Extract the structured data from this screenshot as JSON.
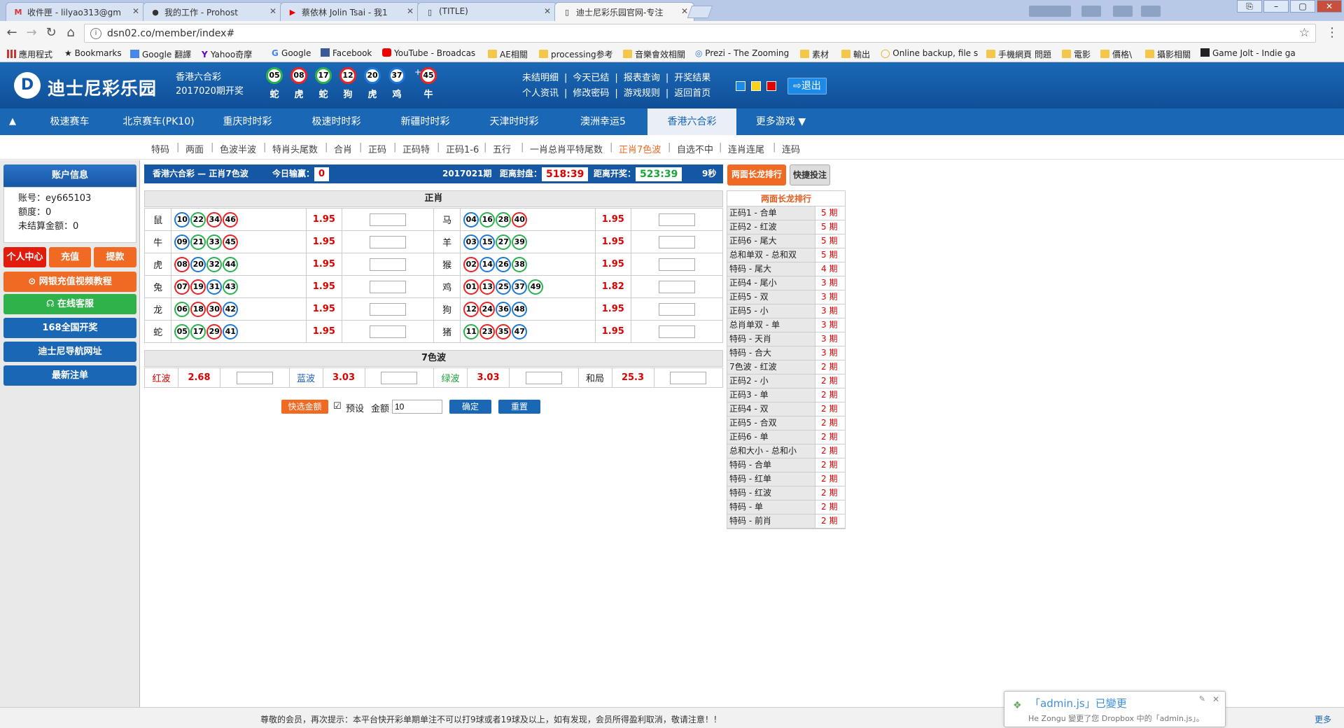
{
  "browser": {
    "tabs": [
      {
        "label": "收件匣 - lilyao313@gm",
        "icon": "gmail-icon"
      },
      {
        "label": "我的工作 - Prohost",
        "icon": "github-icon"
      },
      {
        "label": "蔡依林 Jolin Tsai - 我1",
        "icon": "youtube-icon"
      },
      {
        "label": "(TITLE)",
        "icon": "page-icon"
      },
      {
        "label": "迪士尼彩乐园官网-专注",
        "icon": "page-icon"
      }
    ],
    "url": "dsn02.co/member/index#",
    "bookmarks": [
      "應用程式",
      "Bookmarks",
      "Google 翻譯",
      "Yahoo奇摩",
      "Google",
      "Facebook",
      "YouTube - Broadcas",
      "AE相關",
      "processing参考",
      "音樂會效相關",
      "Prezi - The Zooming",
      "素材",
      "輸出",
      "Online backup, file s",
      "手機網頁 問題",
      "電影",
      "價格\\",
      "攝影相關",
      "Game Jolt - Indie ga"
    ]
  },
  "header": {
    "logo_mark": "D",
    "logo_name": "迪士尼彩乐园",
    "lottery_name": "香港六合彩",
    "period": "2017020期开奖",
    "draw": [
      {
        "num": "05",
        "zodiac": "蛇",
        "color": "green"
      },
      {
        "num": "08",
        "zodiac": "虎",
        "color": "red"
      },
      {
        "num": "17",
        "zodiac": "蛇",
        "color": "green"
      },
      {
        "num": "12",
        "zodiac": "狗",
        "color": "red"
      },
      {
        "num": "20",
        "zodiac": "虎",
        "color": "blue"
      },
      {
        "num": "37",
        "zodiac": "鸡",
        "color": "blue"
      },
      {
        "num": "45",
        "zodiac": "牛",
        "color": "red"
      }
    ],
    "plus": "+",
    "links_row1": [
      "未结明细",
      "今天已结",
      "报表查询",
      "开奖结果"
    ],
    "links_row2": [
      "个人资讯",
      "修改密码",
      "游戏规则",
      "返回首页"
    ],
    "logout": "退出",
    "theme_colors": [
      "#1e8ae8",
      "#f6d21b",
      "#e00000"
    ]
  },
  "nav": {
    "items": [
      "极速赛车",
      "北京赛车(PK10)",
      "重庆时时彩",
      "极速时时彩",
      "新疆时时彩",
      "天津时时彩",
      "澳洲幸运5",
      "香港六合彩",
      "更多游戏 ▼"
    ],
    "active_index": 7,
    "sub": [
      "特码",
      "两面",
      "色波半波",
      "特肖头尾数",
      "合肖",
      "正码",
      "正码特",
      "正码1-6",
      "五行",
      "一肖总肖平特尾数",
      "正肖7色波",
      "自选不中",
      "连肖连尾",
      "连码"
    ],
    "sub_active_index": 10
  },
  "sidebar": {
    "account_title": "账户信息",
    "account_no_label": "账号：ey665103",
    "credit_label": "额度：0",
    "unsettled_label": "未结算金额：0",
    "btn_center": "个人中心",
    "btn_deposit": "充值",
    "btn_withdraw": "提款",
    "btn_video": "网银充值视频教程",
    "btn_service": "在线客服",
    "btn_168": "168全国开奖",
    "btn_nav": "迪士尼导航网址",
    "btn_latest": "最新注单"
  },
  "betbar": {
    "title": "香港六合彩 — 正肖7色波",
    "today_label": "今日输赢：",
    "today_value": "0",
    "period": "2017021期",
    "close_label": "距离封盘：",
    "close_time": "518:39",
    "draw_label": "距离开奖：",
    "draw_time": "523:39",
    "refresh": "9秒"
  },
  "zhengxiao": {
    "title": "正肖",
    "rows": [
      [
        {
          "z": "鼠",
          "odds": "1.95",
          "balls": [
            [
              "10",
              "bl"
            ],
            [
              "22",
              "g"
            ],
            [
              "34",
              "r"
            ],
            [
              "46",
              "r"
            ]
          ]
        },
        {
          "z": "马",
          "odds": "1.95",
          "balls": [
            [
              "04",
              "bl"
            ],
            [
              "16",
              "g"
            ],
            [
              "28",
              "g"
            ],
            [
              "40",
              "r"
            ]
          ]
        }
      ],
      [
        {
          "z": "牛",
          "odds": "1.95",
          "balls": [
            [
              "09",
              "bl"
            ],
            [
              "21",
              "g"
            ],
            [
              "33",
              "g"
            ],
            [
              "45",
              "r"
            ]
          ]
        },
        {
          "z": "羊",
          "odds": "1.95",
          "balls": [
            [
              "03",
              "bl"
            ],
            [
              "15",
              "bl"
            ],
            [
              "27",
              "g"
            ],
            [
              "39",
              "g"
            ]
          ]
        }
      ],
      [
        {
          "z": "虎",
          "odds": "1.95",
          "balls": [
            [
              "08",
              "r"
            ],
            [
              "20",
              "bl"
            ],
            [
              "32",
              "g"
            ],
            [
              "44",
              "g"
            ]
          ]
        },
        {
          "z": "猴",
          "odds": "1.95",
          "balls": [
            [
              "02",
              "r"
            ],
            [
              "14",
              "bl"
            ],
            [
              "26",
              "bl"
            ],
            [
              "38",
              "g"
            ]
          ]
        }
      ],
      [
        {
          "z": "兔",
          "odds": "1.95",
          "balls": [
            [
              "07",
              "r"
            ],
            [
              "19",
              "r"
            ],
            [
              "31",
              "bl"
            ],
            [
              "43",
              "g"
            ]
          ]
        },
        {
          "z": "鸡",
          "odds": "1.82",
          "balls": [
            [
              "01",
              "r"
            ],
            [
              "13",
              "r"
            ],
            [
              "25",
              "bl"
            ],
            [
              "37",
              "bl"
            ],
            [
              "49",
              "g"
            ]
          ]
        }
      ],
      [
        {
          "z": "龙",
          "odds": "1.95",
          "balls": [
            [
              "06",
              "g"
            ],
            [
              "18",
              "r"
            ],
            [
              "30",
              "r"
            ],
            [
              "42",
              "bl"
            ]
          ]
        },
        {
          "z": "狗",
          "odds": "1.95",
          "balls": [
            [
              "12",
              "r"
            ],
            [
              "24",
              "r"
            ],
            [
              "36",
              "bl"
            ],
            [
              "48",
              "bl"
            ]
          ]
        }
      ],
      [
        {
          "z": "蛇",
          "odds": "1.95",
          "balls": [
            [
              "05",
              "g"
            ],
            [
              "17",
              "g"
            ],
            [
              "29",
              "r"
            ],
            [
              "41",
              "bl"
            ]
          ]
        },
        {
          "z": "猪",
          "odds": "1.95",
          "balls": [
            [
              "11",
              "g"
            ],
            [
              "23",
              "r"
            ],
            [
              "35",
              "r"
            ],
            [
              "47",
              "bl"
            ]
          ]
        }
      ]
    ]
  },
  "colorwave": {
    "title": "7色波",
    "items": [
      {
        "label": "红波",
        "odds": "2.68",
        "color": "#d00"
      },
      {
        "label": "蓝波",
        "odds": "3.03",
        "color": "#1e5fc0"
      },
      {
        "label": "绿波",
        "odds": "3.03",
        "color": "#1aa53a"
      },
      {
        "label": "和局",
        "odds": "25.3",
        "color": "#222"
      }
    ]
  },
  "controls": {
    "quick_amount": "快选金额",
    "preset_label": "预设",
    "amount_label": "金额",
    "amount_value": "10",
    "confirm": "确定",
    "reset": "重置"
  },
  "rightpanel": {
    "tab_long": "两面长龙排行",
    "tab_quick": "快捷投注",
    "head": "两面长龙排行",
    "rows": [
      [
        "正码1 - 合单",
        "5 期"
      ],
      [
        "正码2 - 红波",
        "5 期"
      ],
      [
        "正码6 - 尾大",
        "5 期"
      ],
      [
        "总和单双 - 总和双",
        "5 期"
      ],
      [
        "特码 - 尾大",
        "4 期"
      ],
      [
        "正码4 - 尾小",
        "3 期"
      ],
      [
        "正码5 - 双",
        "3 期"
      ],
      [
        "正码5 - 小",
        "3 期"
      ],
      [
        "总肖单双 - 单",
        "3 期"
      ],
      [
        "特码 - 天肖",
        "3 期"
      ],
      [
        "特码 - 合大",
        "3 期"
      ],
      [
        "7色波 - 红波",
        "2 期"
      ],
      [
        "正码2 - 小",
        "2 期"
      ],
      [
        "正码3 - 单",
        "2 期"
      ],
      [
        "正码4 - 双",
        "2 期"
      ],
      [
        "正码5 - 合双",
        "2 期"
      ],
      [
        "正码6 - 单",
        "2 期"
      ],
      [
        "总和大小 - 总和小",
        "2 期"
      ],
      [
        "特码 - 合单",
        "2 期"
      ],
      [
        "特码 - 红单",
        "2 期"
      ],
      [
        "特码 - 红波",
        "2 期"
      ],
      [
        "特码 - 单",
        "2 期"
      ],
      [
        "特码 - 前肖",
        "2 期"
      ]
    ]
  },
  "footer": {
    "message": "尊敬的会员，再次提示：本平台快开彩单期单注不可以打9球或者19球及以上，如有发现，会员所得盈利取消，敬请注意！！",
    "more": "更多"
  },
  "toast": {
    "title": "「admin.js」已變更",
    "body": "He Zongu 變更了您 Dropbox 中的「admin.js」。"
  }
}
